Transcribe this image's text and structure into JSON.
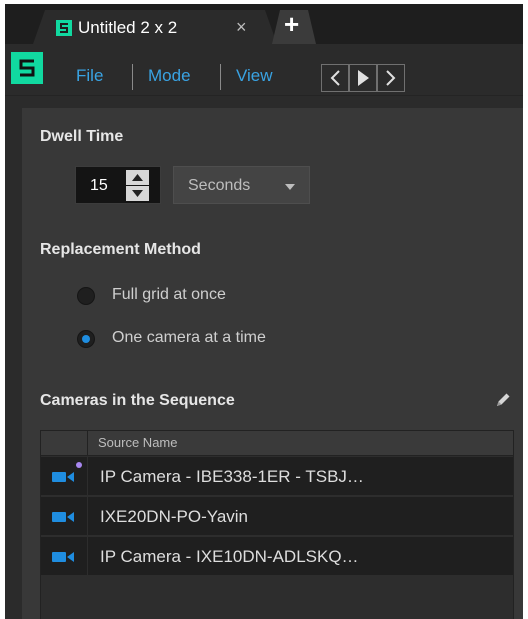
{
  "tab": {
    "title": "Untitled 2 x 2",
    "close_glyph": "×",
    "new_tab_glyph": "+"
  },
  "menu": {
    "items": [
      "File",
      "Mode",
      "View"
    ],
    "nav": {
      "prev_icon": "chevron-left-icon",
      "play_icon": "play-icon",
      "next_icon": "chevron-right-icon"
    }
  },
  "dwell": {
    "title": "Dwell Time",
    "value": "15",
    "unit": "Seconds"
  },
  "replacement": {
    "title": "Replacement Method",
    "options": [
      {
        "label": "Full grid at once",
        "checked": false
      },
      {
        "label": "One camera at a time",
        "checked": true
      }
    ]
  },
  "cameras": {
    "title": "Cameras in the Sequence",
    "column_header": "Source Name",
    "rows": [
      {
        "name": "IP Camera - IBE338-1ER - TSBJ…",
        "has_status_dot": true
      },
      {
        "name": "IXE20DN-PO-Yavin",
        "has_status_dot": false
      },
      {
        "name": "IP Camera - IXE10DN-ADLSKQ…",
        "has_status_dot": false
      }
    ]
  },
  "colors": {
    "accent_blue": "#39a3e3",
    "brand_green": "#11d9a0",
    "camera_icon": "#1f8de0",
    "status_dot": "#a887f0"
  }
}
